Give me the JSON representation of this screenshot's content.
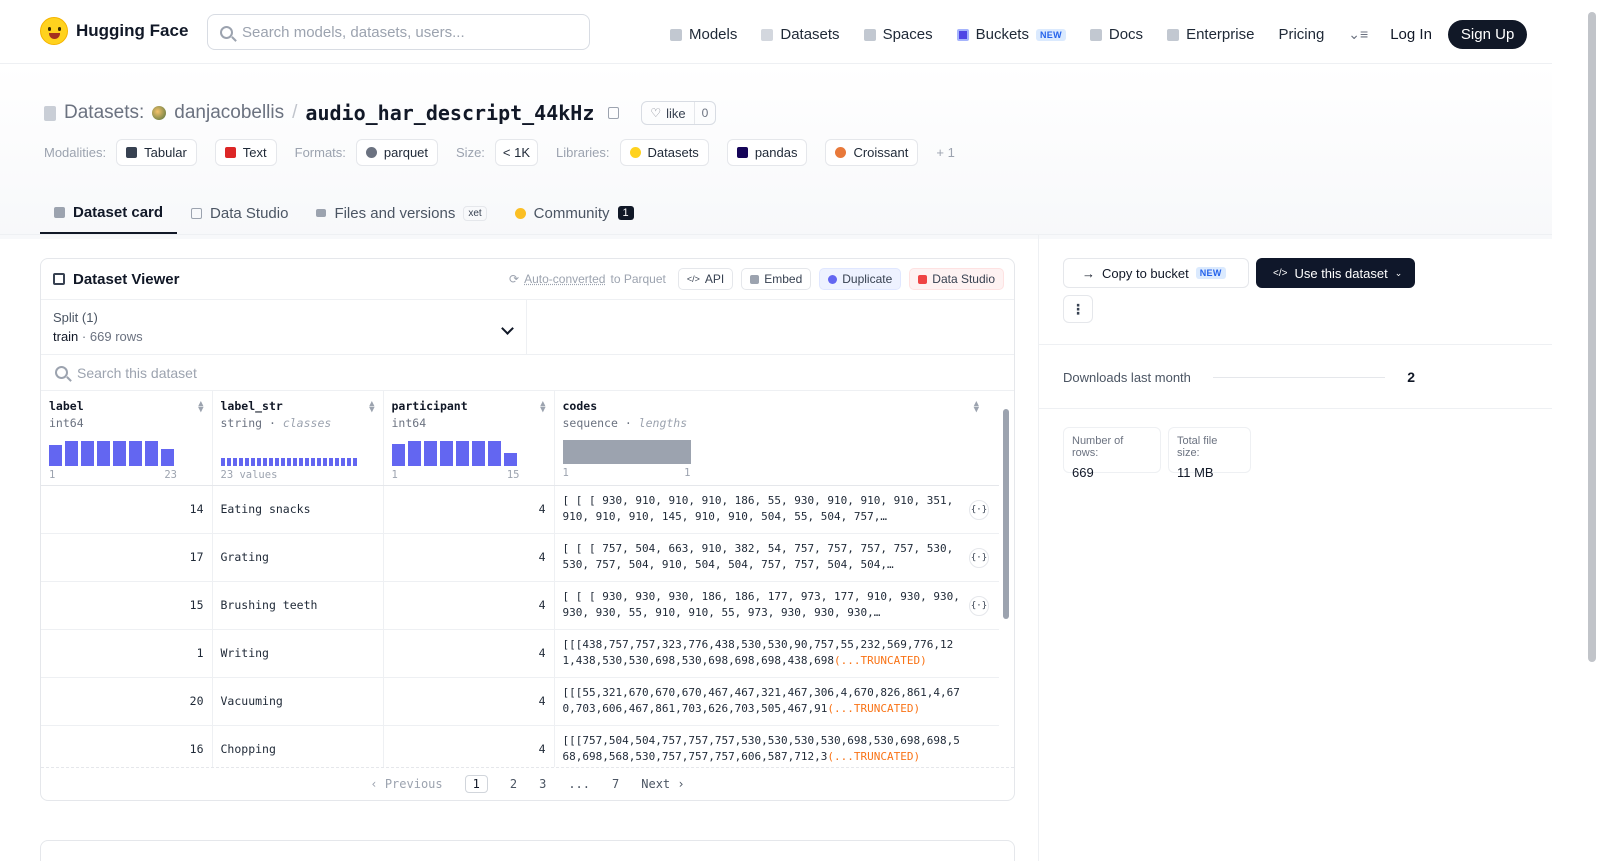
{
  "nav": {
    "logo": "Hugging Face",
    "search_placeholder": "Search models, datasets, users...",
    "links": [
      {
        "label": "Models",
        "icon": "models-icon"
      },
      {
        "label": "Datasets",
        "icon": "datasets-icon"
      },
      {
        "label": "Spaces",
        "icon": "spaces-icon"
      },
      {
        "label": "Buckets",
        "icon": "buckets-icon",
        "badge": "NEW"
      },
      {
        "label": "Docs",
        "icon": "docs-icon"
      },
      {
        "label": "Enterprise",
        "icon": "enterprise-icon"
      },
      {
        "label": "Pricing"
      }
    ],
    "login": "Log In",
    "signup": "Sign Up"
  },
  "header": {
    "crumb": "Datasets:",
    "owner": "danjacobellis",
    "slash": "/",
    "repo": "audio_har_descript_44kHz",
    "like_label": "like",
    "like_count": "0"
  },
  "meta": {
    "modalities_label": "Modalities:",
    "modalities": [
      "Tabular",
      "Text"
    ],
    "formats_label": "Formats:",
    "formats": [
      "parquet"
    ],
    "size_label": "Size:",
    "size": "< 1K",
    "libraries_label": "Libraries:",
    "libraries": [
      "Datasets",
      "pandas",
      "Croissant"
    ],
    "libraries_more": "+ 1"
  },
  "tabs": [
    {
      "label": "Dataset card",
      "active": true
    },
    {
      "label": "Data Studio"
    },
    {
      "label": "Files and versions",
      "badge": "xet"
    },
    {
      "label": "Community",
      "count": "1"
    }
  ],
  "viewer": {
    "title": "Dataset Viewer",
    "auto_converted": "Auto-converted",
    "auto_suffix": "to Parquet",
    "actions": [
      "API",
      "Embed",
      "Duplicate",
      "Data Studio"
    ],
    "split_label": "Split (1)",
    "split_name": "train",
    "split_sep": "·",
    "split_rows": "669 rows",
    "search_placeholder": "Search this dataset",
    "columns": [
      {
        "name": "label",
        "type": "int64",
        "extra": "",
        "range_min": "1",
        "range_max": "23"
      },
      {
        "name": "label_str",
        "type": "string",
        "extra": "classes",
        "range_min": "23 values",
        "range_max": ""
      },
      {
        "name": "participant",
        "type": "int64",
        "extra": "",
        "range_min": "1",
        "range_max": "15"
      },
      {
        "name": "codes",
        "type": "sequence",
        "extra": "lengths",
        "range_min": "1",
        "range_max": "1"
      }
    ],
    "type_sep": " · ",
    "hist_label": [
      0.75,
      0.9,
      0.9,
      0.9,
      0.9,
      0.9,
      0.9,
      0.6
    ],
    "hist_participant": [
      0.8,
      0.9,
      0.9,
      0.9,
      0.9,
      0.9,
      0.9,
      0.45
    ],
    "rows": [
      {
        "label": "14",
        "label_str": "Eating snacks",
        "participant": "4",
        "codes": "[ [ [ 930, 910, 910, 910, 186, 55, 930, 910, 910, 910, 351, 910, 910, 910, 145, 910, 910, 504, 55, 504, 757,…",
        "trunc": ""
      },
      {
        "label": "17",
        "label_str": "Grating",
        "participant": "4",
        "codes": "[ [ [ 757, 504, 663, 910, 382, 54, 757, 757, 757, 757, 530, 530, 757, 504, 910, 504, 504, 757, 757, 504, 504,…",
        "trunc": ""
      },
      {
        "label": "15",
        "label_str": "Brushing teeth",
        "participant": "4",
        "codes": "[ [ [ 930, 930, 930, 186, 186, 177, 973, 177, 910, 930, 930, 930, 930, 55, 910, 910, 55, 973, 930, 930, 930,…",
        "trunc": ""
      },
      {
        "label": "1",
        "label_str": "Writing",
        "participant": "4",
        "codes": "[[[438,757,757,323,776,438,530,530,90,757,55,232,569,776,121,438,530,530,698,530,698,698,698,438,698",
        "trunc": "(...TRUNCATED)"
      },
      {
        "label": "20",
        "label_str": "Vacuuming",
        "participant": "4",
        "codes": "[[[55,321,670,670,670,467,467,321,467,306,4,670,826,861,4,670,703,606,467,861,703,626,703,505,467,91",
        "trunc": "(...TRUNCATED)"
      },
      {
        "label": "16",
        "label_str": "Chopping",
        "participant": "4",
        "codes": "[[[757,504,504,757,757,757,530,530,530,530,698,530,698,698,568,698,568,530,757,757,757,606,587,712,3",
        "trunc": "(...TRUNCATED)"
      }
    ],
    "pager": {
      "prev": "Previous",
      "pages": [
        "1",
        "2",
        "3",
        "...",
        "7"
      ],
      "next": "Next"
    }
  },
  "sidebar": {
    "copy_bucket": "Copy to bucket",
    "copy_badge": "NEW",
    "use_dataset": "Use this dataset",
    "more": "⋮",
    "downloads_label": "Downloads last month",
    "downloads_value": "2",
    "rows_label": "Number of rows:",
    "rows_value": "669",
    "size_label": "Total file size:",
    "size_value": "11 MB"
  }
}
